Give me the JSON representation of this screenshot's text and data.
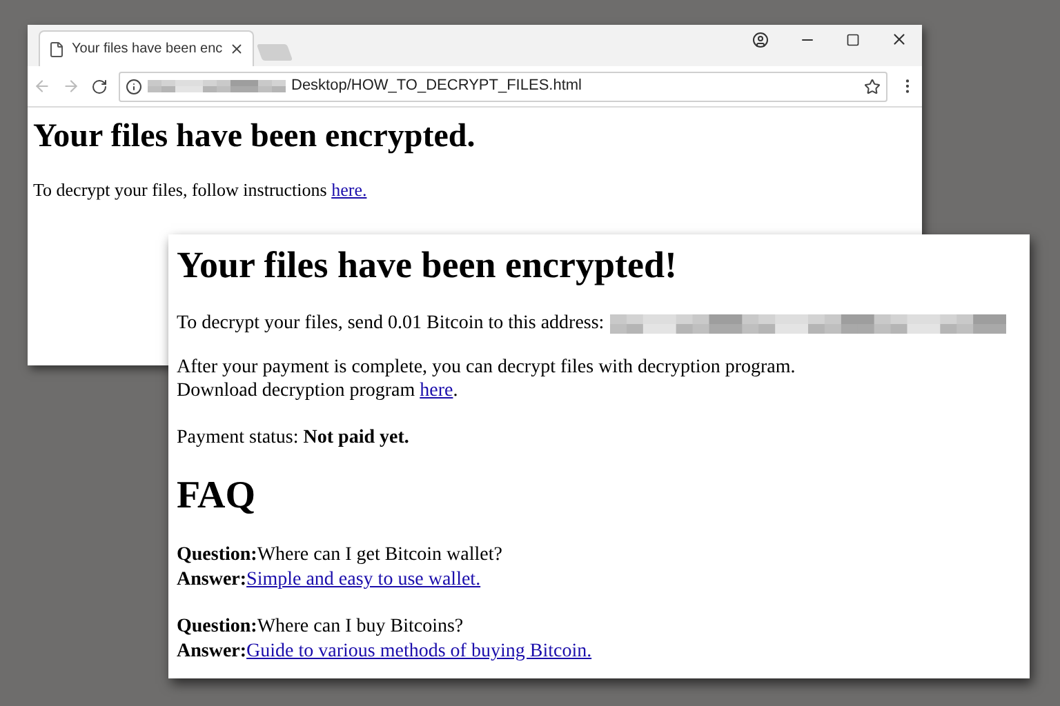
{
  "browser_window": {
    "tab": {
      "title": "Your files have been enc",
      "selected": true
    },
    "address": "Desktop/HOW_TO_DECRYPT_FILES.html",
    "page": {
      "heading": "Your files have been encrypted.",
      "text": "To decrypt your files, follow instructions",
      "link": "here."
    }
  },
  "note_window": {
    "heading": "Your files have been encrypted!",
    "address_line": "To decrypt your files, send 0.01 Bitcoin to this address:",
    "payment_text": "After your payment is complete, you can decrypt files with decryption program.",
    "download_text": "Download decryption program",
    "download_link": "here",
    "download_end": ".",
    "status_label": "Payment status:",
    "status_value": "Not paid yet.",
    "faq_heading": "FAQ",
    "faq": [
      {
        "question_label": "Question:",
        "question": "Where can I get Bitcoin wallet?",
        "answer_label": "Answer:",
        "answer": "Simple and easy to use wallet."
      },
      {
        "question_label": "Question:",
        "question": "Where can I buy Bitcoins?",
        "answer_label": "Answer:",
        "answer": "Guide to various methods of buying Bitcoin."
      }
    ]
  }
}
